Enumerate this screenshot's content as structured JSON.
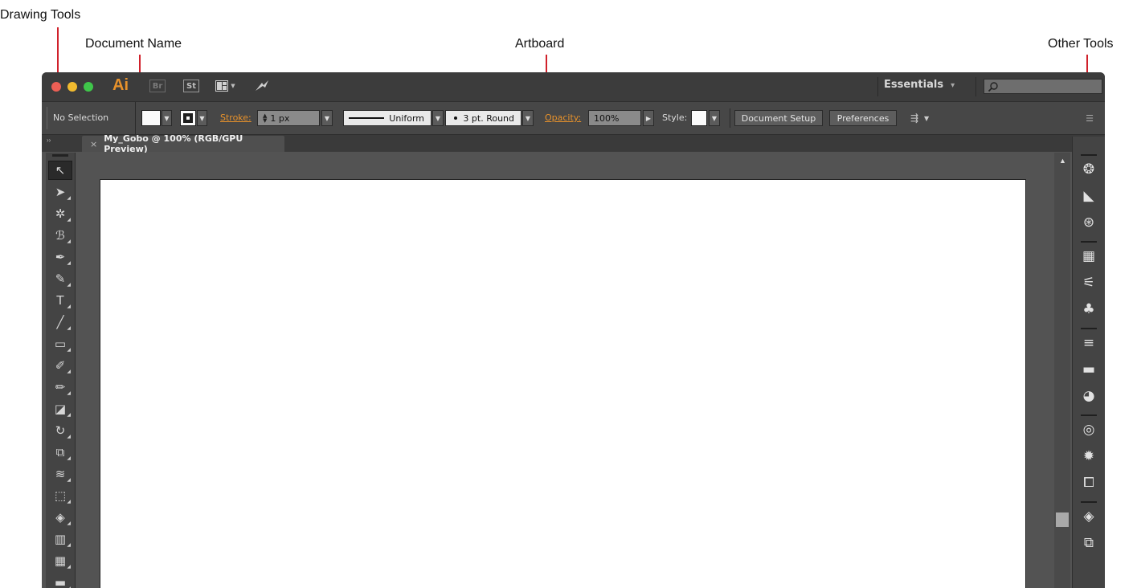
{
  "callouts": {
    "drawing_tools": "Drawing Tools",
    "document_name": "Document Name",
    "artboard": "Artboard",
    "other_tools": "Other Tools"
  },
  "app_bar": {
    "logo": "Ai",
    "bridge_icon": "Br",
    "stock_icon": "St",
    "arrange_icon": "arrange-documents-icon",
    "sync_icon": "gpu-performance-icon",
    "workspace": "Essentials",
    "workspace_caret": "▾",
    "search_placeholder": ""
  },
  "control_bar": {
    "selection_label": "No Selection",
    "stroke_label": "Stroke:",
    "stroke_weight": "1 px",
    "stroke_profile": "Uniform",
    "brush": "3 pt. Round",
    "opacity_label": "Opacity:",
    "opacity_value": "100%",
    "style_label": "Style:",
    "document_setup": "Document Setup",
    "preferences": "Preferences"
  },
  "document_tab": {
    "close": "×",
    "title": "My_Gobo @ 100% (RGB/GPU Preview)"
  },
  "tools": [
    {
      "name": "selection-tool-icon",
      "glyph": "↖"
    },
    {
      "name": "direct-selection-tool-icon",
      "glyph": "➤"
    },
    {
      "name": "magic-wand-tool-icon",
      "glyph": "✲"
    },
    {
      "name": "lasso-tool-icon",
      "glyph": "ℬ"
    },
    {
      "name": "pen-tool-icon",
      "glyph": "✒"
    },
    {
      "name": "curvature-tool-icon",
      "glyph": "✎"
    },
    {
      "name": "type-tool-icon",
      "glyph": "T"
    },
    {
      "name": "line-segment-tool-icon",
      "glyph": "╱"
    },
    {
      "name": "rectangle-tool-icon",
      "glyph": "▭"
    },
    {
      "name": "paintbrush-tool-icon",
      "glyph": "✐"
    },
    {
      "name": "shaper-tool-icon",
      "glyph": "✏"
    },
    {
      "name": "eraser-tool-icon",
      "glyph": "◪"
    },
    {
      "name": "rotate-tool-icon",
      "glyph": "↻"
    },
    {
      "name": "scale-tool-icon",
      "glyph": "⧉"
    },
    {
      "name": "warp-tool-icon",
      "glyph": "≋"
    },
    {
      "name": "free-transform-tool-icon",
      "glyph": "⬚"
    },
    {
      "name": "shape-builder-tool-icon",
      "glyph": "◈"
    },
    {
      "name": "graph-tool-icon",
      "glyph": "▥"
    },
    {
      "name": "mesh-tool-icon",
      "glyph": "▦"
    },
    {
      "name": "gradient-tool-icon",
      "glyph": "▬"
    }
  ],
  "panel_icons": [
    {
      "name": "color-panel-icon",
      "glyph": "❂"
    },
    {
      "name": "color-guide-panel-icon",
      "glyph": "◣"
    },
    {
      "name": "color-themes-panel-icon",
      "glyph": "⊛"
    },
    {
      "name": "swatches-panel-icon",
      "glyph": "▦"
    },
    {
      "name": "brushes-panel-icon",
      "glyph": "⚟"
    },
    {
      "name": "symbols-panel-icon",
      "glyph": "♣"
    },
    {
      "name": "stroke-panel-icon",
      "glyph": "≡"
    },
    {
      "name": "gradient-panel-icon",
      "glyph": "▬"
    },
    {
      "name": "transparency-panel-icon",
      "glyph": "◕"
    },
    {
      "name": "libraries-panel-icon",
      "glyph": "◎"
    },
    {
      "name": "appearance-panel-icon",
      "glyph": "✹"
    },
    {
      "name": "asset-export-panel-icon",
      "glyph": "⧠"
    },
    {
      "name": "layers-panel-icon",
      "glyph": "◈"
    },
    {
      "name": "artboards-panel-icon",
      "glyph": "⧉"
    }
  ],
  "colors": {
    "accent_orange": "#e8922b",
    "callout_red": "#d0212b",
    "ui_dark": "#3c3c3c",
    "canvas_gray": "#535353"
  }
}
